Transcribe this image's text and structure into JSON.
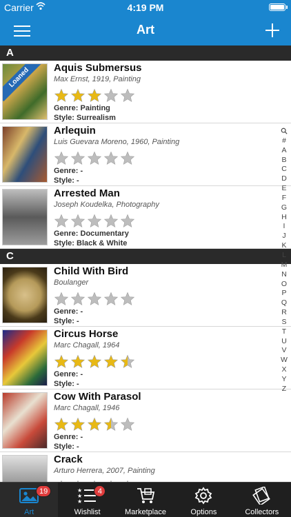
{
  "status_bar": {
    "carrier": "Carrier",
    "time": "4:19 PM"
  },
  "nav": {
    "title": "Art"
  },
  "colors": {
    "accent": "#1a86cf",
    "star_filled": "#e8b915",
    "star_empty": "#bdbdbd",
    "badge": "#e03c3c"
  },
  "sections": [
    {
      "letter": "A",
      "items": [
        {
          "title": "Aquis Submersus",
          "subtitle": "Max Ernst, 1919, Painting",
          "rating": 3,
          "genre": "Genre: Painting",
          "style": "Style: Surrealism",
          "loaned": "Loaned"
        },
        {
          "title": "Arlequin",
          "subtitle": "Luis Guevara Moreno, 1960, Painting",
          "rating": 0,
          "genre": "Genre: -",
          "style": "Style: -"
        },
        {
          "title": "Arrested Man",
          "subtitle": "Joseph Koudelka, Photography",
          "rating": 0,
          "genre": "Genre: Documentary",
          "style": "Style: Black & White"
        }
      ]
    },
    {
      "letter": "C",
      "items": [
        {
          "title": "Child With Bird",
          "subtitle": "Boulanger",
          "rating": 0,
          "genre": "Genre: -",
          "style": "Style: -"
        },
        {
          "title": "Circus Horse",
          "subtitle": "Marc Chagall, 1964",
          "rating": 4.5,
          "genre": "Genre: -",
          "style": "Style: -"
        },
        {
          "title": "Cow With Parasol",
          "subtitle": "Marc Chagall, 1946",
          "rating": 3.5,
          "genre": "Genre: -",
          "style": "Style: -"
        },
        {
          "title": "Crack",
          "subtitle": "Arturo Herrera, 2007, Painting",
          "rating": 0,
          "genre": "",
          "style": ""
        }
      ]
    }
  ],
  "index": [
    "Q",
    "#",
    "A",
    "B",
    "C",
    "D",
    "E",
    "F",
    "G",
    "H",
    "I",
    "J",
    "K",
    "L",
    "M",
    "N",
    "O",
    "P",
    "Q",
    "R",
    "S",
    "T",
    "U",
    "V",
    "W",
    "X",
    "Y",
    "Z"
  ],
  "tabs": [
    {
      "label": "Art",
      "icon": "art-icon",
      "badge": "19",
      "active": true
    },
    {
      "label": "Wishlist",
      "icon": "wishlist-icon",
      "badge": "4"
    },
    {
      "label": "Marketplace",
      "icon": "cart-icon"
    },
    {
      "label": "Options",
      "icon": "gear-icon"
    },
    {
      "label": "Collectors",
      "icon": "collectors-icon"
    }
  ]
}
